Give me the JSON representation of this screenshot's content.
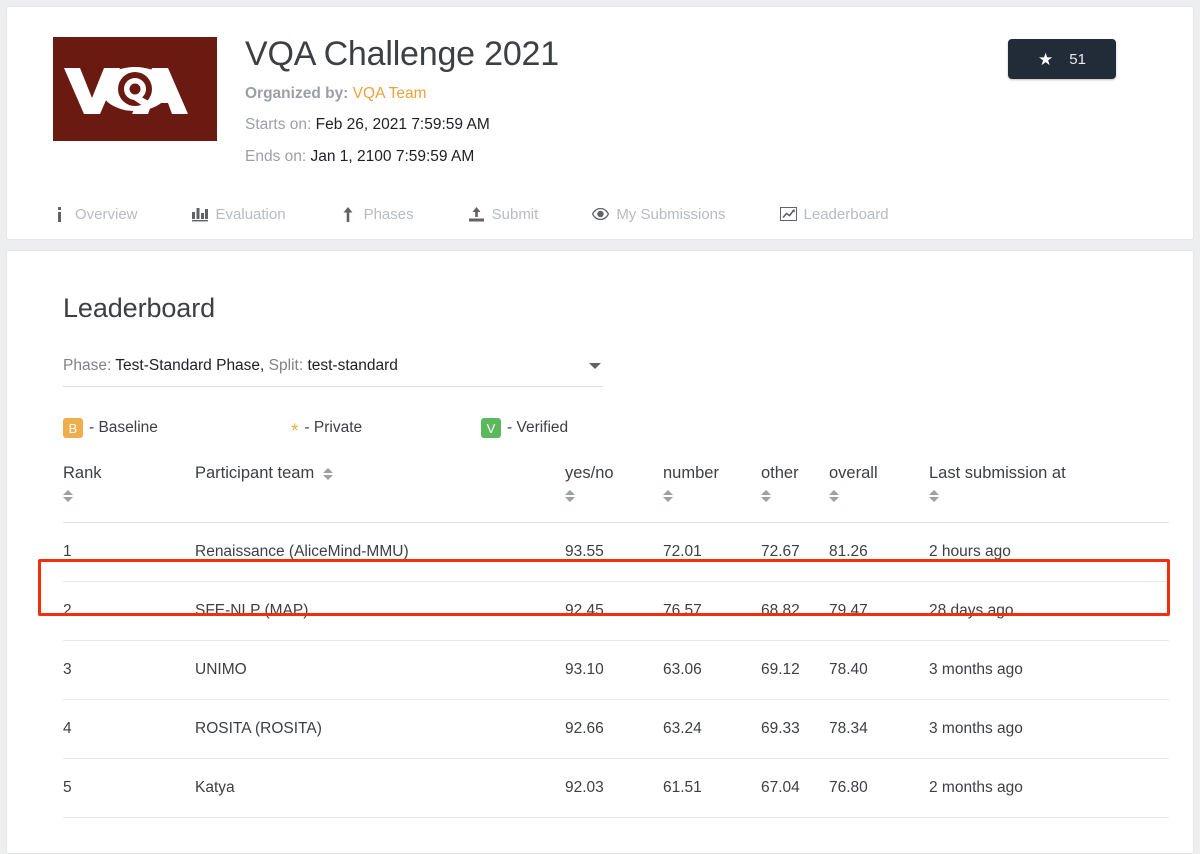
{
  "header": {
    "logo_alt": "VQA",
    "title": "VQA Challenge 2021",
    "organized_by_label": "Organized by:",
    "organizer": "VQA Team",
    "starts_label": "Starts on:",
    "starts_value": "Feb 26, 2021 7:59:59 AM",
    "ends_label": "Ends on:",
    "ends_value": "Jan 1, 2100 7:59:59 AM",
    "star_count": "51",
    "star_icon": "star-icon",
    "logo_color": "#6b1a11",
    "link_color": "#e8a33d"
  },
  "tabs": [
    {
      "label": "Overview",
      "icon": "info-icon"
    },
    {
      "label": "Evaluation",
      "icon": "bar-chart-icon"
    },
    {
      "label": "Phases",
      "icon": "upload-arrow-icon"
    },
    {
      "label": "Submit",
      "icon": "upload-tray-icon"
    },
    {
      "label": "My Submissions",
      "icon": "eye-icon"
    },
    {
      "label": "Leaderboard",
      "icon": "trend-line-icon"
    }
  ],
  "leaderboard": {
    "title": "Leaderboard",
    "phase_select": {
      "phase_label": "Phase:",
      "phase_value": "Test-Standard Phase,",
      "split_label": "Split:",
      "split_value": "test-standard",
      "caret_icon": "chevron-down-icon"
    },
    "legend": [
      {
        "badge": "B",
        "text": "- Baseline",
        "color": "#f0ad4e",
        "type": "square"
      },
      {
        "badge": "*",
        "text": "- Private",
        "color": "#f0ad4e",
        "type": "star"
      },
      {
        "badge": "V",
        "text": "- Verified",
        "color": "#5cb85c",
        "type": "square"
      }
    ],
    "columns": [
      {
        "key": "rank",
        "label": "Rank",
        "sortable": true
      },
      {
        "key": "team",
        "label": "Participant team",
        "sortable": true
      },
      {
        "key": "yesno",
        "label": "yes/no",
        "sortable": true
      },
      {
        "key": "number",
        "label": "number",
        "sortable": true
      },
      {
        "key": "other",
        "label": "other",
        "sortable": true
      },
      {
        "key": "overall",
        "label": "overall",
        "sortable": true
      },
      {
        "key": "last",
        "label": "Last submission at",
        "sortable": true
      }
    ],
    "rows": [
      {
        "rank": "1",
        "team": "Renaissance (AliceMind-MMU)",
        "yesno": "93.55",
        "number": "72.01",
        "other": "72.67",
        "overall": "81.26",
        "last": "2 hours ago",
        "highlighted": true
      },
      {
        "rank": "2",
        "team": "SFE-NLP (MAP)",
        "yesno": "92.45",
        "number": "76.57",
        "other": "68.82",
        "overall": "79.47",
        "last": "28 days ago",
        "highlighted": false
      },
      {
        "rank": "3",
        "team": "UNIMO",
        "yesno": "93.10",
        "number": "63.06",
        "other": "69.12",
        "overall": "78.40",
        "last": "3 months ago",
        "highlighted": false
      },
      {
        "rank": "4",
        "team": "ROSITA (ROSITA)",
        "yesno": "92.66",
        "number": "63.24",
        "other": "69.33",
        "overall": "78.34",
        "last": "3 months ago",
        "highlighted": false
      },
      {
        "rank": "5",
        "team": "Katya",
        "yesno": "92.03",
        "number": "61.51",
        "other": "67.04",
        "overall": "76.80",
        "last": "2 months ago",
        "highlighted": false
      }
    ],
    "highlight_color": "#f42d0a"
  }
}
